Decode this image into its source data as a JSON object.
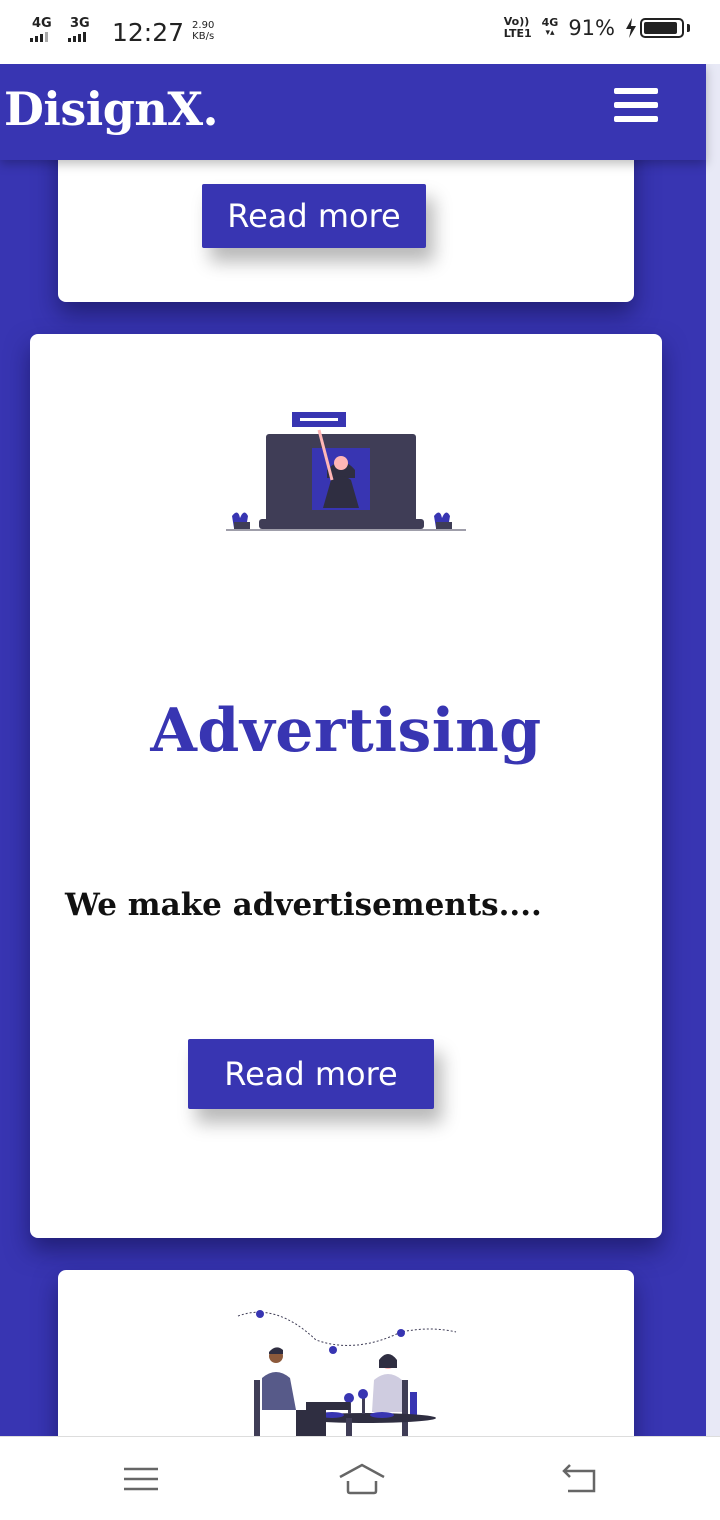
{
  "status_bar": {
    "network_1": "4G",
    "network_2": "3G",
    "time": "12:27",
    "speed_value": "2.90",
    "speed_unit": "KB/s",
    "volte_top": "Vo))",
    "volte_bottom": "LTE1",
    "network_right": "4G",
    "battery_percent": "91%",
    "battery_level": 0.91
  },
  "header": {
    "brand": "DisignX.",
    "menu_icon": "hamburger-icon"
  },
  "cards": {
    "top": {
      "button_label": "Read more"
    },
    "main": {
      "illustration": "advertising-illustration",
      "title": "Advertising",
      "description": "We make advertisements....",
      "button_label": "Read more"
    },
    "bottom": {
      "illustration": "dinner-illustration"
    }
  },
  "system_nav": {
    "menu_icon": "menu-icon",
    "home_icon": "home-icon",
    "back_icon": "back-icon"
  },
  "colors": {
    "brand_primary": "#3835b2",
    "card_bg": "#ffffff",
    "text_dark": "#111111"
  }
}
